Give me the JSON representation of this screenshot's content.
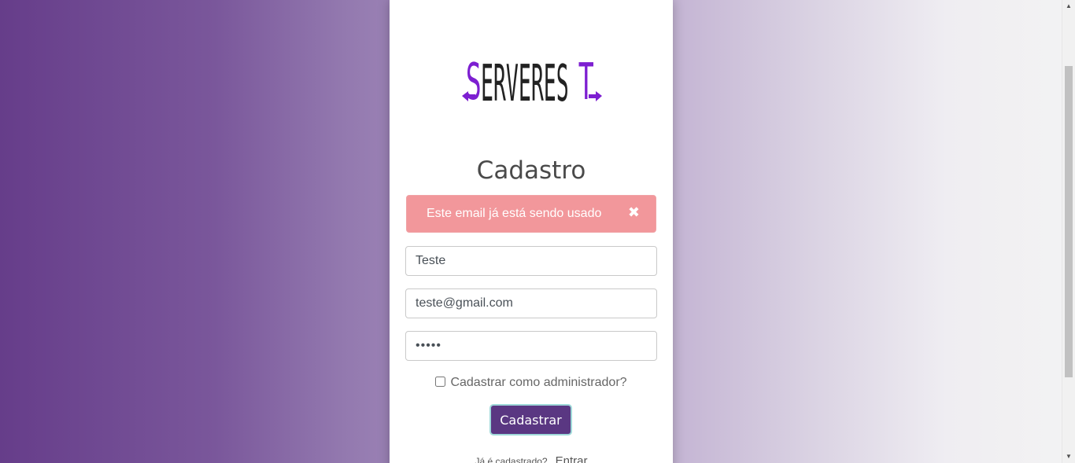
{
  "logo": {
    "text": "SERVEREST",
    "icon": "serverest-logo"
  },
  "page": {
    "title": "Cadastro"
  },
  "alert": {
    "message": "Este email já está sendo usado",
    "close_symbol": "✖"
  },
  "form": {
    "name_value": "Teste",
    "email_value": "teste@gmail.com",
    "password_value": "•••••",
    "admin_checkbox_label": "Cadastrar como administrador?",
    "admin_checked": false,
    "submit_label": "Cadastrar"
  },
  "footer": {
    "question": "Já é cadastrado?",
    "login_link": "Entrar"
  },
  "scrollbar": {
    "up_icon": "▲",
    "down_icon": "▼"
  },
  "colors": {
    "accent": "#5a3782",
    "alert_bg": "#f2979b",
    "logo_purple": "#7d1fd1",
    "logo_dark": "#222222"
  }
}
